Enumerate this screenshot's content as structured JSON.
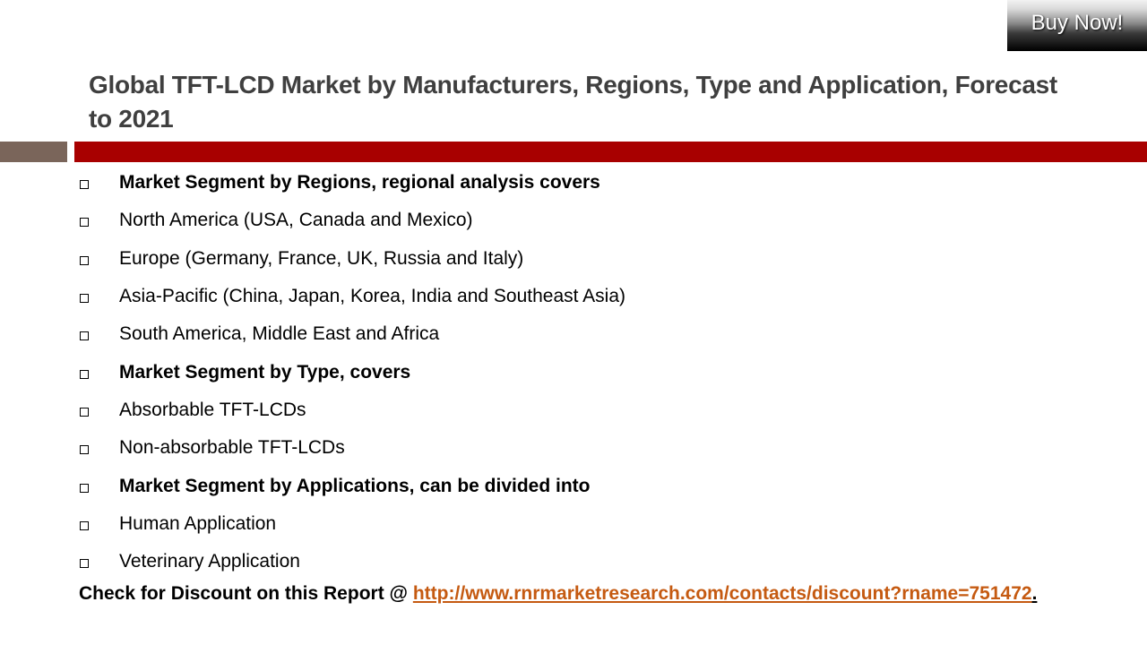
{
  "buy_button": {
    "label": "Buy Now!"
  },
  "title": "Global TFT-LCD Market by Manufacturers, Regions, Type and Application, Forecast to 2021",
  "items": [
    {
      "text": "Market Segment by Regions, regional analysis covers",
      "bold": true
    },
    {
      "text": "North America (USA, Canada and Mexico)",
      "bold": false
    },
    {
      "text": "Europe (Germany, France, UK, Russia and Italy)",
      "bold": false
    },
    {
      "text": "Asia-Pacific (China, Japan, Korea, India and Southeast Asia)",
      "bold": false
    },
    {
      "text": "South America, Middle East and Africa",
      "bold": false
    },
    {
      "text": "Market Segment by Type, covers",
      "bold": true
    },
    {
      "text": "Absorbable TFT-LCDs",
      "bold": false
    },
    {
      "text": "Non-absorbable TFT-LCDs",
      "bold": false
    },
    {
      "text": "Market Segment by Applications, can be divided into",
      "bold": true
    },
    {
      "text": "Human Application",
      "bold": false
    },
    {
      "text": "Veterinary Application",
      "bold": false
    }
  ],
  "footer": {
    "prefix": "Check for Discount on this Report @ ",
    "link_text": "http://www.rnrmarketresearch.com/contacts/discount?rname=751472",
    "suffix": "."
  },
  "colors": {
    "title": "#3f3f3f",
    "bar_left": "#7a655a",
    "bar_right": "#a80000",
    "link": "#c55a11"
  }
}
